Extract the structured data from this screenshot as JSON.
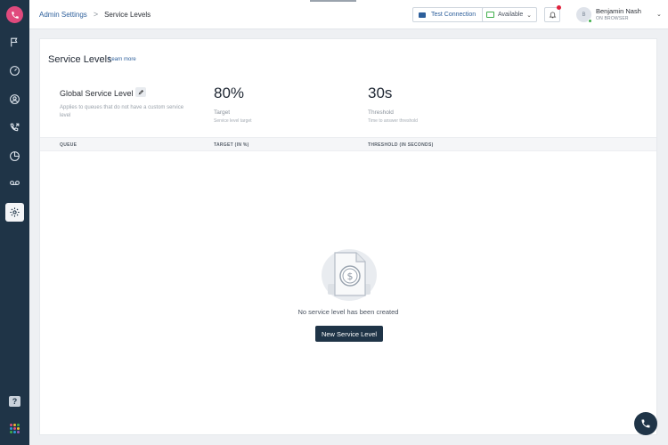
{
  "breadcrumb": {
    "parent": "Admin Settings",
    "separator": ">",
    "current": "Service Levels"
  },
  "header": {
    "test_connection_label": "Test Connection",
    "status_value": "Available",
    "user_initial": "B",
    "user_name": "Benjamin Nash",
    "user_subtitle": "ON BROWSER"
  },
  "page": {
    "title": "Service Levels",
    "learn_more": "Learn more"
  },
  "global_level": {
    "title": "Global Service Level",
    "description": "Applies to queues that do not have a custom service level",
    "target_value": "80%",
    "target_label": "Target",
    "target_sub": "Service level target",
    "threshold_value": "30s",
    "threshold_label": "Threshold",
    "threshold_sub": "Time to answer threshold"
  },
  "table": {
    "columns": [
      "QUEUE",
      "TARGET (IN %)",
      "THRESHOLD (IN SECONDS)"
    ]
  },
  "empty_state": {
    "message": "No service level has been created",
    "button_label": "New Service Level"
  },
  "help_label": "?",
  "colors": {
    "sidebar": "#1f3447",
    "brand": "#e04a7d",
    "link": "#2d5f9b",
    "online": "#3fae4a",
    "alert": "#e0213c"
  },
  "icons": [
    "phone-icon",
    "flag-icon",
    "gauge-icon",
    "user-icon",
    "call-route-icon",
    "pie-chart-icon",
    "voicemail-icon",
    "gear-icon",
    "help-icon",
    "apps-grid-icon",
    "bell-icon",
    "monitor-icon",
    "pencil-icon",
    "dollar-document-icon"
  ]
}
